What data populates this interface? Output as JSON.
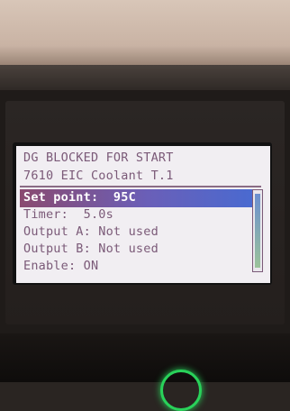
{
  "display": {
    "header_line1": "DG BLOCKED FOR START",
    "header_line2": "7610 EIC Coolant T.1",
    "menu": [
      {
        "text": "Set point:  95C",
        "selected": true
      },
      {
        "text": "Timer:  5.0s",
        "selected": false
      },
      {
        "text": "Output A: Not used",
        "selected": false
      },
      {
        "text": "Output B: Not used",
        "selected": false
      },
      {
        "text": "Enable: ON",
        "selected": false
      }
    ],
    "text_color": "#7b5a78",
    "selection_color": "#6a5fb8",
    "background_color": "#f1eef2"
  },
  "led": {
    "color": "#29d25a",
    "icon": "power-led-icon"
  }
}
